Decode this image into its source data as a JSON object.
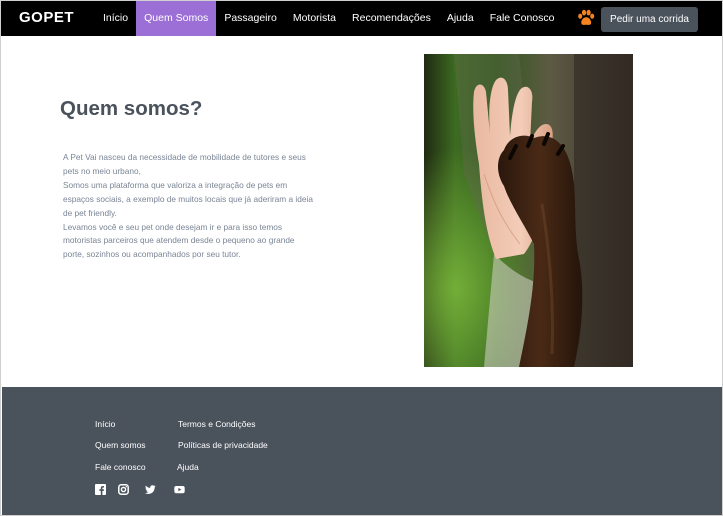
{
  "brand": "GOPET",
  "nav": {
    "items": [
      {
        "label": "Início",
        "active": false
      },
      {
        "label": "Quem Somos",
        "active": true
      },
      {
        "label": "Passageiro",
        "active": false
      },
      {
        "label": "Motorista",
        "active": false
      },
      {
        "label": "Recomendações",
        "active": false
      },
      {
        "label": "Ajuda",
        "active": false
      },
      {
        "label": "Fale Conosco",
        "active": false
      }
    ],
    "cta_label": "Pedir uma corrida",
    "paw_icon": "paw-icon"
  },
  "about": {
    "title": "Quem somos?",
    "paragraphs": [
      "A Pet Vai nasceu da necessidade de mobilidade de tutores e seus pets no meio urbano,",
      "Somos uma plataforma que valoriza a integração de pets em espaços sociais, a exemplo de muitos locais que já aderiram a ideia de pet friendly.",
      "Levamos você e seu pet onde desejam ir e para isso temos motoristas parceiros que atendem desde o pequeno ao grande porte, sozinhos ou acompanhados por seu tutor."
    ]
  },
  "footer": {
    "col1": [
      "Início",
      "Quem somos",
      "Fale conosco"
    ],
    "col2": [
      "Termos e Condições",
      "Políticas de privacidade",
      "Ajuda"
    ],
    "social": [
      "facebook-icon",
      "instagram-icon",
      "twitter-icon",
      "youtube-icon"
    ]
  },
  "colors": {
    "nav_bg": "#000000",
    "nav_active": "#9b6fd6",
    "accent_paw": "#f5841f",
    "dark_slate": "#4a525c",
    "body_text": "#7a8595"
  }
}
